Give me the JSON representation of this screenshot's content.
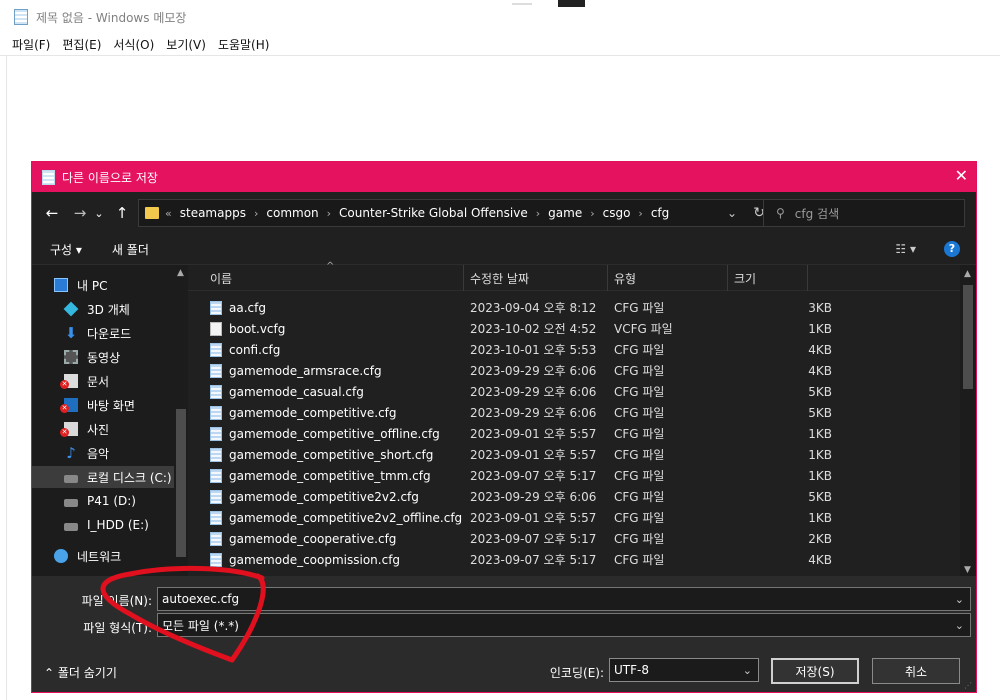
{
  "notepad": {
    "title": "제목 없음 - Windows 메모장",
    "menu": [
      "파일(F)",
      "편집(E)",
      "서식(O)",
      "보기(V)",
      "도움말(H)"
    ]
  },
  "dialog": {
    "title": "다른 이름으로 저장",
    "close": "✕",
    "nav": {
      "back": "←",
      "forward": "→",
      "recent": "⌄",
      "up": "↑"
    },
    "address": {
      "prefix": "«",
      "segments": [
        "steamapps",
        "common",
        "Counter-Strike Global Offensive",
        "game",
        "csgo",
        "cfg"
      ],
      "separator": "›"
    },
    "search_placeholder": "cfg 검색",
    "toolbar": {
      "organize": "구성 ▾",
      "new_folder": "새 폴더",
      "view": "☷ ▾",
      "help": "?"
    },
    "sidebar": [
      {
        "label": "내 PC",
        "icon": "pc-icon"
      },
      {
        "label": "3D 개체",
        "icon": "cube-icon"
      },
      {
        "label": "다운로드",
        "icon": "download-icon"
      },
      {
        "label": "동영상",
        "icon": "video-icon"
      },
      {
        "label": "문서",
        "icon": "document-icon"
      },
      {
        "label": "바탕 화면",
        "icon": "desktop-icon"
      },
      {
        "label": "사진",
        "icon": "picture-icon"
      },
      {
        "label": "음악",
        "icon": "music-icon"
      },
      {
        "label": "로컬 디스크 (C:)",
        "icon": "drive-icon"
      },
      {
        "label": "P41 (D:)",
        "icon": "drive-icon"
      },
      {
        "label": "I_HDD (E:)",
        "icon": "drive-icon"
      },
      {
        "label": "네트워크",
        "icon": "network-icon"
      }
    ],
    "columns": {
      "name": "이름",
      "date": "수정한 날짜",
      "type": "유형",
      "size": "크기"
    },
    "files": [
      {
        "name": "aa.cfg",
        "date": "2023-09-04 오후 8:12",
        "type": "CFG 파일",
        "size": "3KB"
      },
      {
        "name": "boot.vcfg",
        "date": "2023-10-02 오전 4:52",
        "type": "VCFG 파일",
        "size": "1KB"
      },
      {
        "name": "confi.cfg",
        "date": "2023-10-01 오후 5:53",
        "type": "CFG 파일",
        "size": "4KB"
      },
      {
        "name": "gamemode_armsrace.cfg",
        "date": "2023-09-29 오후 6:06",
        "type": "CFG 파일",
        "size": "4KB"
      },
      {
        "name": "gamemode_casual.cfg",
        "date": "2023-09-29 오후 6:06",
        "type": "CFG 파일",
        "size": "5KB"
      },
      {
        "name": "gamemode_competitive.cfg",
        "date": "2023-09-29 오후 6:06",
        "type": "CFG 파일",
        "size": "5KB"
      },
      {
        "name": "gamemode_competitive_offline.cfg",
        "date": "2023-09-01 오후 5:57",
        "type": "CFG 파일",
        "size": "1KB"
      },
      {
        "name": "gamemode_competitive_short.cfg",
        "date": "2023-09-01 오후 5:57",
        "type": "CFG 파일",
        "size": "1KB"
      },
      {
        "name": "gamemode_competitive_tmm.cfg",
        "date": "2023-09-07 오후 5:17",
        "type": "CFG 파일",
        "size": "1KB"
      },
      {
        "name": "gamemode_competitive2v2.cfg",
        "date": "2023-09-29 오후 6:06",
        "type": "CFG 파일",
        "size": "5KB"
      },
      {
        "name": "gamemode_competitive2v2_offline.cfg",
        "date": "2023-09-01 오후 5:57",
        "type": "CFG 파일",
        "size": "1KB"
      },
      {
        "name": "gamemode_cooperative.cfg",
        "date": "2023-09-07 오후 5:17",
        "type": "CFG 파일",
        "size": "2KB"
      },
      {
        "name": "gamemode_coopmission.cfg",
        "date": "2023-09-07 오후 5:17",
        "type": "CFG 파일",
        "size": "4KB"
      }
    ],
    "filename_label": "파일 이름(N):",
    "filename_value": "autoexec.cfg",
    "filetype_label": "파일 형식(T):",
    "filetype_value": "모든 파일 (*.*)",
    "hide_folders": "⌃ 폴더 숨기기",
    "encoding_label": "인코딩(E):",
    "encoding_value": "UTF-8",
    "save_button": "저장(S)",
    "cancel_button": "취소"
  },
  "colors": {
    "accent": "#e5135f",
    "annotation": "#e0101e",
    "dialog_bg": "#202020"
  }
}
